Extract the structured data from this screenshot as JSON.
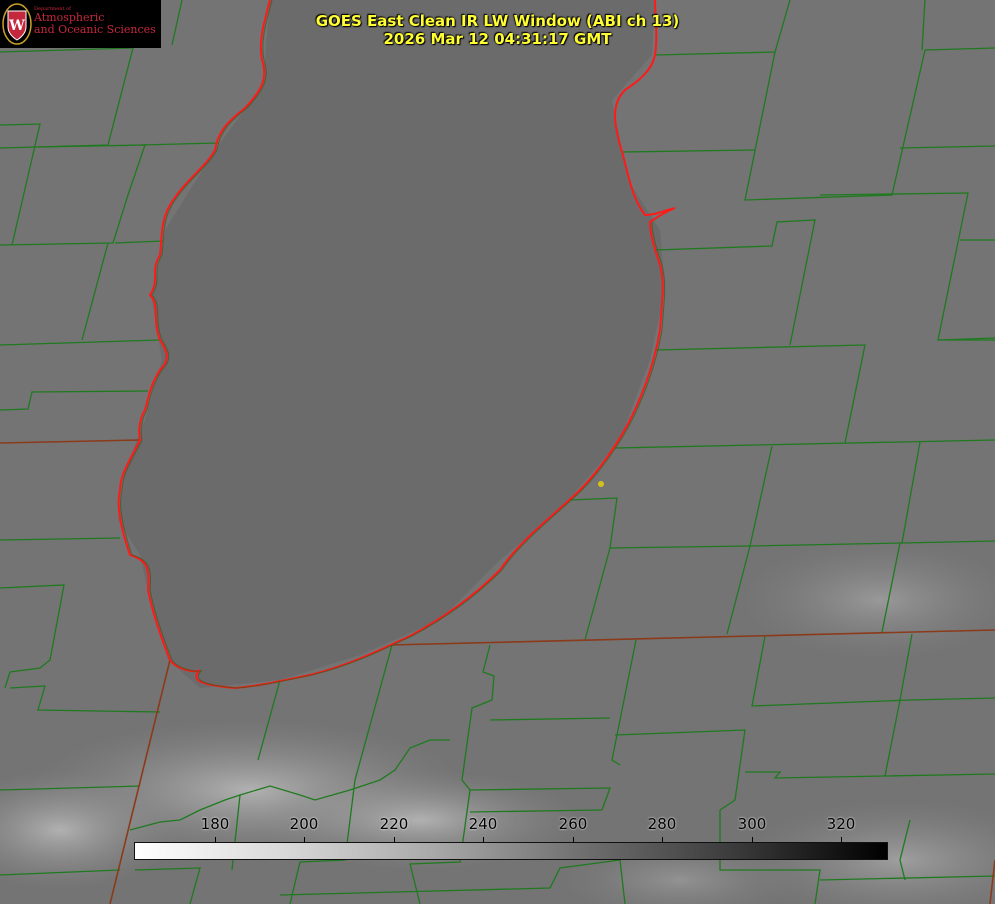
{
  "title": {
    "line1": "GOES East Clean IR LW Window (ABI ch 13)",
    "line2": "2026 Mar 12 04:31:17 GMT"
  },
  "logo": {
    "dept": "Department of",
    "line1": "Atmospheric",
    "line2": "and Oceanic Sciences",
    "shield_letter": "W"
  },
  "colorbar": {
    "ticks": [
      "180",
      "200",
      "220",
      "240",
      "260",
      "280",
      "300",
      "320"
    ]
  },
  "colors": {
    "county_lines": "#1f7a1f",
    "state_lines": "#8b3a1a",
    "lake_shore": "#ff1a1a",
    "title": "#ffff33",
    "marker": "#d4c21a"
  }
}
